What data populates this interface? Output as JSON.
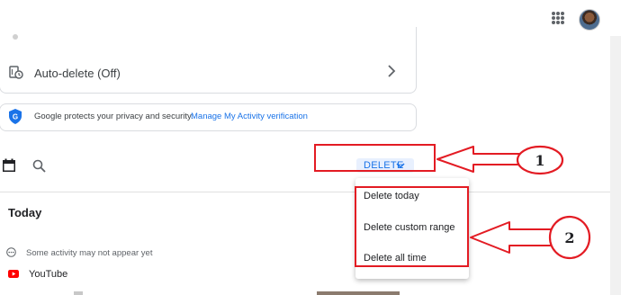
{
  "auto_delete": {
    "label": "Auto-delete (Off)",
    "icon": "auto-delete-icon"
  },
  "privacy": {
    "text": "Google protects your privacy and security.",
    "link": "Manage My Activity verification"
  },
  "toolbar": {
    "delete_label": "DELETE",
    "accent_color": "#1a73e8"
  },
  "delete_menu": {
    "items": [
      {
        "label": "Delete today"
      },
      {
        "label": "Delete custom range"
      },
      {
        "label": "Delete all time"
      }
    ]
  },
  "today": {
    "heading": "Today",
    "notice": "Some activity may not appear yet",
    "app": "YouTube"
  },
  "annotations": {
    "step1": "1",
    "step2": "2",
    "color": "#e31b23"
  }
}
